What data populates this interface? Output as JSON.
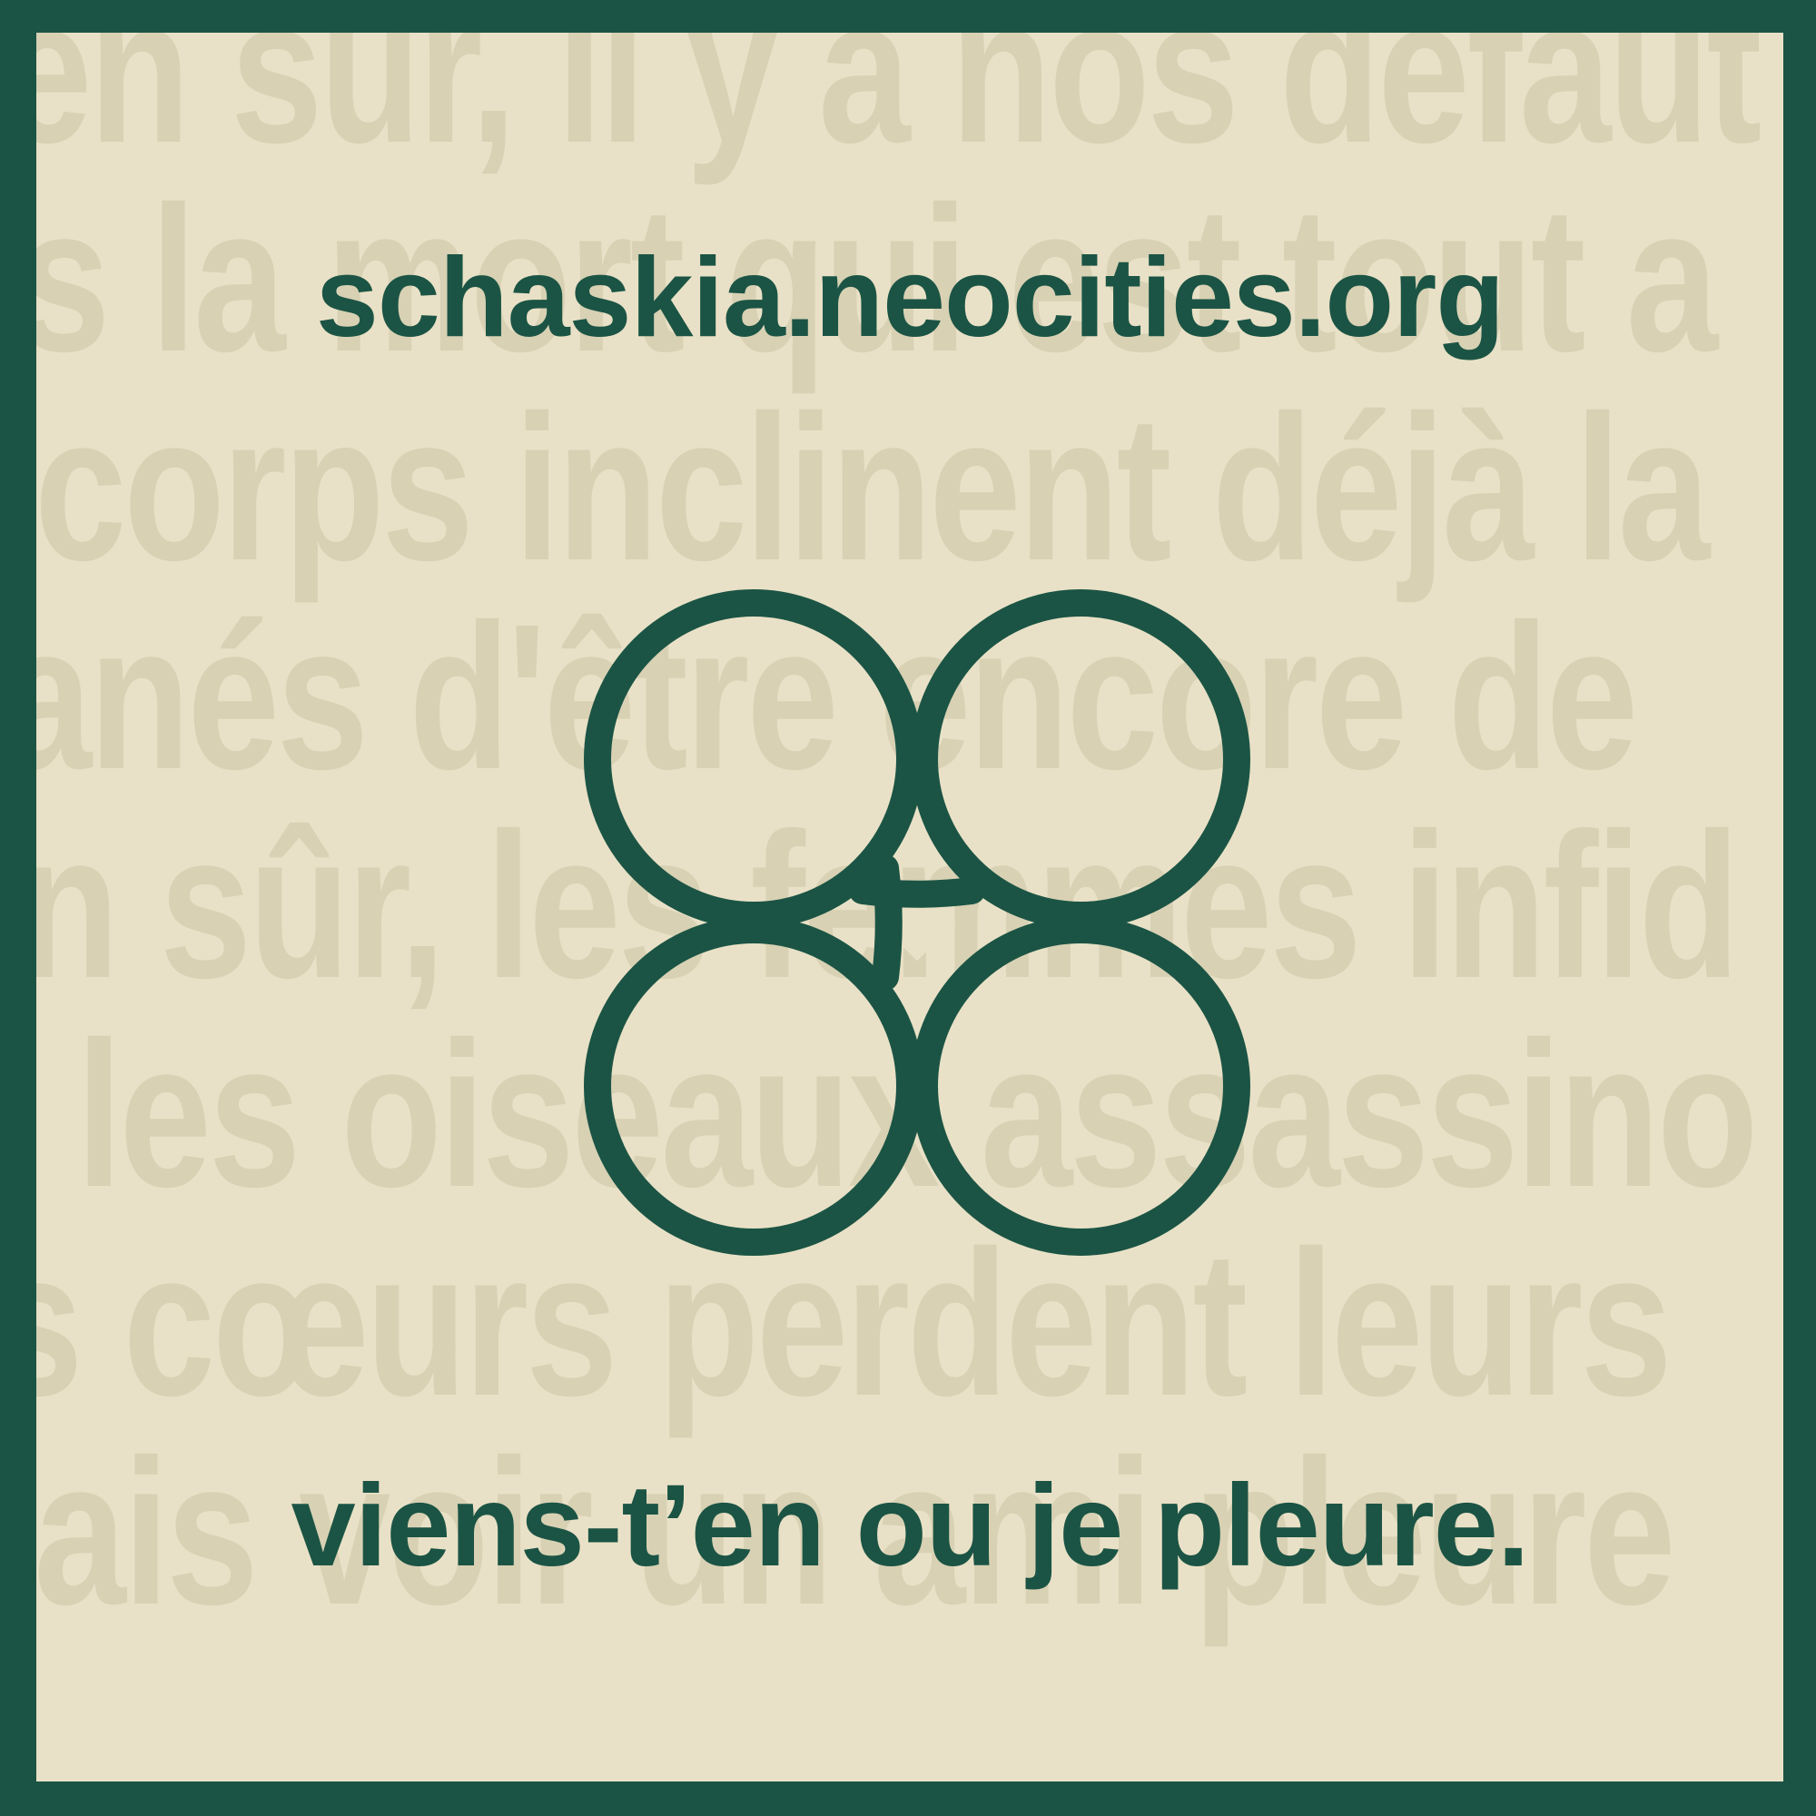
{
  "site_url": "schaskia.neocities.org",
  "tagline": "viens-t’en ou je pleure.",
  "logo_icon": "four-loop-clover-icon",
  "background_text_lines": [
    "en sûr, il y a nos défaut",
    "s la mort qui est tout a",
    "corps inclinent déjà la",
    "anés d'être encore de",
    "n sûr, les femmes infid",
    "les oiseaux assassino",
    "s cœurs perdent leurs",
    "lais voir un ami pleure"
  ],
  "colors": {
    "frame": "#1b5444",
    "panel": "#e9e1c7",
    "background_text": "#d8d1b4",
    "accent": "#1b5444"
  }
}
